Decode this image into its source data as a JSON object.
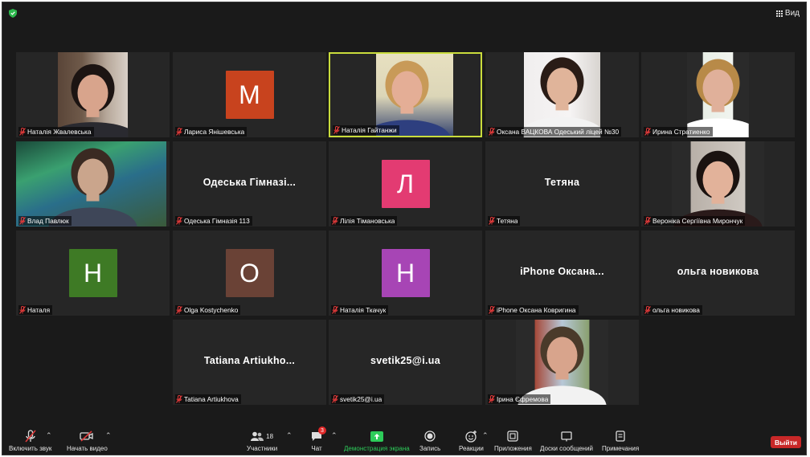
{
  "header": {
    "view_label": "Вид"
  },
  "participants": [
    {
      "name": "Наталія Жвалевська",
      "type": "video"
    },
    {
      "name": "Лариса Янішевська",
      "type": "avatar",
      "initial": "М",
      "color": "#c8431e"
    },
    {
      "name": "Наталія Гайтанжи",
      "type": "video",
      "active": true
    },
    {
      "name": "Оксана  ВАЦКОВА  Одеський ліцей №30",
      "type": "video"
    },
    {
      "name": "Ирина Стратиенко",
      "type": "video"
    },
    {
      "name": "Влад Павлюк",
      "type": "video"
    },
    {
      "name": "Одеська Гімназія 113",
      "type": "text",
      "display": "Одеська  Гімназі..."
    },
    {
      "name": "Лілія Тімановська",
      "type": "avatar",
      "initial": "Л",
      "color": "#e33b72"
    },
    {
      "name": "Тетяна",
      "type": "text",
      "display": "Тетяна"
    },
    {
      "name": "Вероніка Сергіївна Мирончук",
      "type": "video"
    },
    {
      "name": "Наталя",
      "type": "avatar",
      "initial": "Н",
      "color": "#3e7a25"
    },
    {
      "name": "Olga Kostychenko",
      "type": "avatar",
      "initial": "О",
      "color": "#6a4236"
    },
    {
      "name": "Наталія Ткачук",
      "type": "avatar",
      "initial": "Н",
      "color": "#a745b5"
    },
    {
      "name": "iPhone Оксана Ковригина",
      "type": "text",
      "display": "iPhone  Оксана..."
    },
    {
      "name": "ольга новикова",
      "type": "text",
      "display": "ольга новикова"
    },
    {
      "name": "Tatiana Artiukhova",
      "type": "text",
      "display": "Tatiana  Artiukho..."
    },
    {
      "name": "svetik25@i.ua",
      "type": "text",
      "display": "svetik25@i.ua"
    },
    {
      "name": "Ірина Єфремова",
      "type": "video"
    }
  ],
  "toolbar": {
    "unmute": "Включить звук",
    "start_video": "Начать видео",
    "participants": "Участники",
    "participants_count": "18",
    "chat": "Чат",
    "chat_badge": "3",
    "share": "Демонстрация экрана",
    "record": "Запись",
    "reactions": "Реакции",
    "apps": "Приложения",
    "whiteboards": "Доски сообщений",
    "notes": "Примечания",
    "leave": "Выйти"
  },
  "colors": {
    "share_green": "#2dcc5a",
    "leave_red": "#c82828",
    "active_border": "#c9dc3c"
  }
}
